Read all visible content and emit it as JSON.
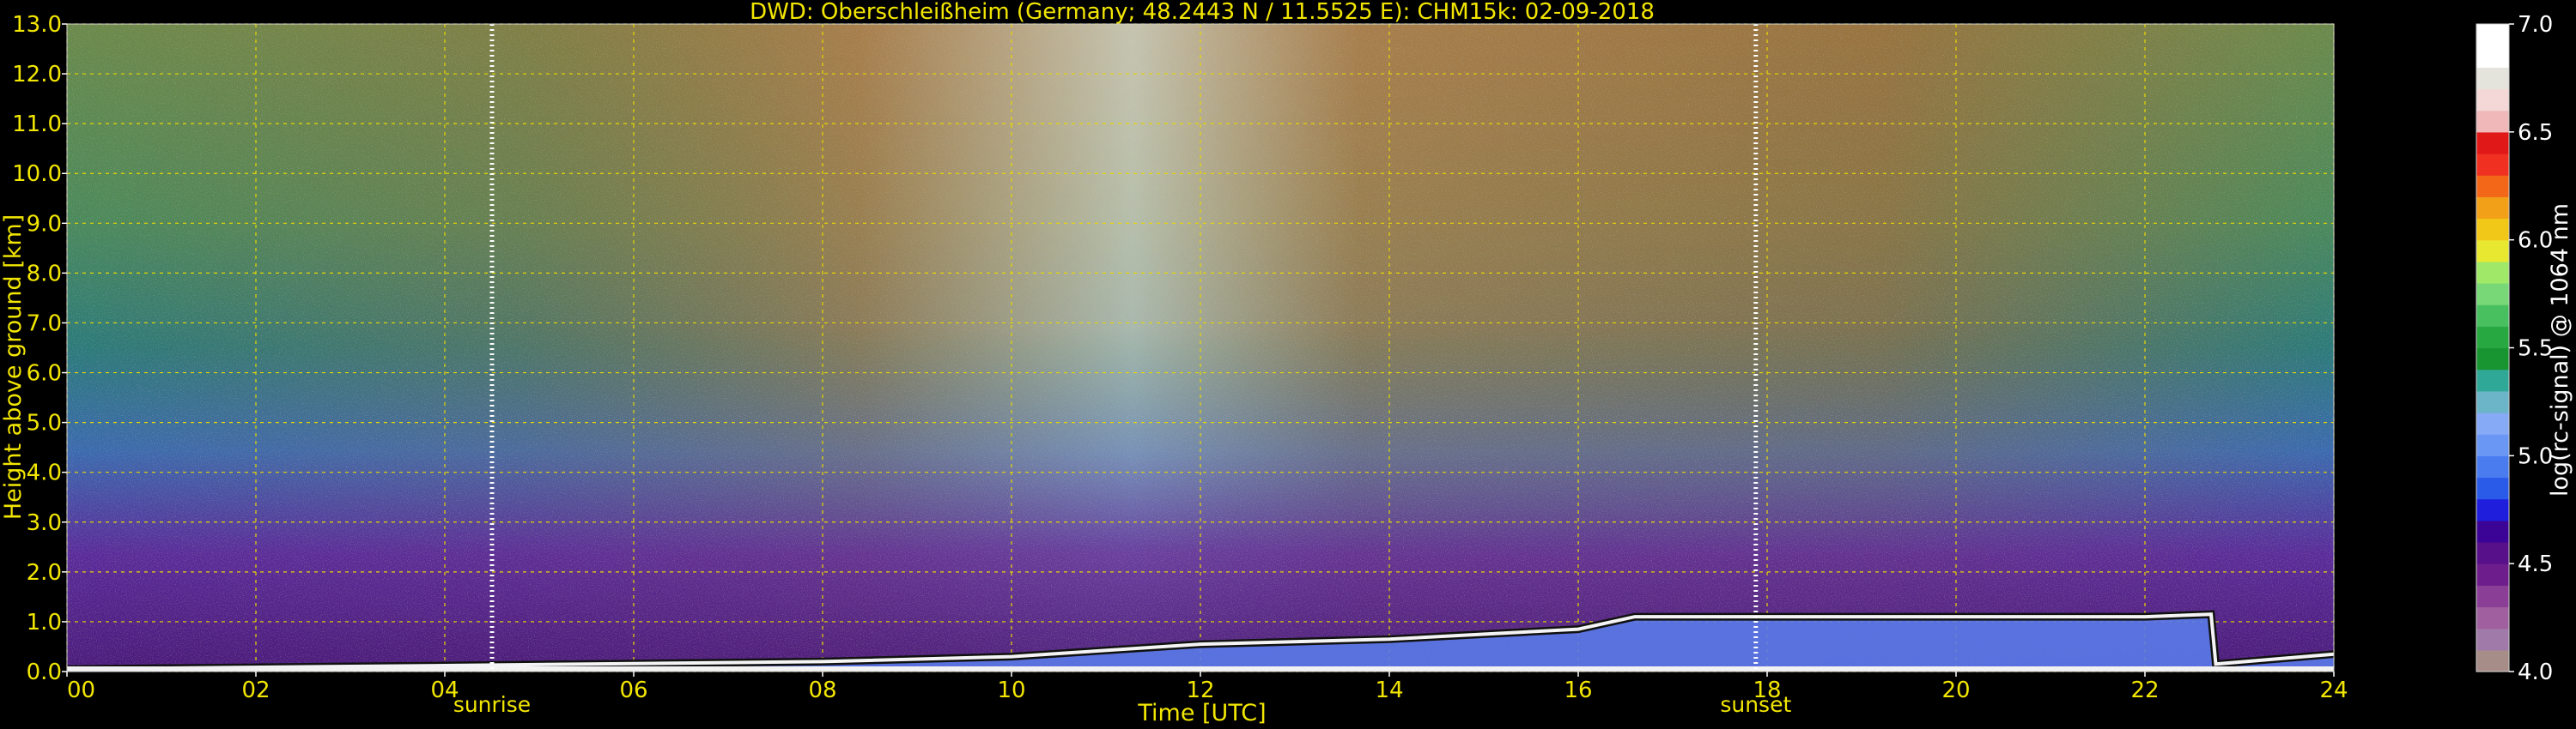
{
  "chart_data": {
    "type": "heatmap",
    "title": "DWD: Oberschleißheim (Germany; 48.2443 N / 11.5525 E):    CHM15k: 02-09-2018",
    "xlabel": "Time [UTC]",
    "ylabel": "Height above ground [km]",
    "xlim": [
      0,
      24
    ],
    "ylim": [
      0,
      13
    ],
    "x_ticks": [
      "00",
      "02",
      "04",
      "06",
      "08",
      "10",
      "12",
      "14",
      "16",
      "18",
      "20",
      "22",
      "24"
    ],
    "y_ticks": [
      "0.0",
      "1.0",
      "2.0",
      "3.0",
      "4.0",
      "5.0",
      "6.0",
      "7.0",
      "8.0",
      "9.0",
      "10.0",
      "11.0",
      "12.0",
      "13.0"
    ],
    "grid": true,
    "annotations": [
      {
        "label": "sunrise",
        "x": 4.5
      },
      {
        "label": "sunset",
        "x": 17.88
      }
    ],
    "colorbar": {
      "label": "log(rc-signal) @ 1064 nm",
      "range": [
        4.0,
        7.0
      ],
      "ticks": [
        "4.0",
        "4.5",
        "5.0",
        "5.5",
        "6.0",
        "6.5",
        "7.0"
      ],
      "colors": [
        "#a78d88",
        "#a07aa8",
        "#a060a0",
        "#8a3e96",
        "#6e1e8c",
        "#58108a",
        "#3c0496",
        "#1e1edc",
        "#2a5ae8",
        "#4a7cf0",
        "#6a96f4",
        "#86aaf6",
        "#6cb4c8",
        "#30a898",
        "#189430",
        "#28a840",
        "#48c060",
        "#78d878",
        "#a0e868",
        "#e8e830",
        "#f2c818",
        "#f2a018",
        "#f26818",
        "#f03020",
        "#e01818",
        "#f0b8b8",
        "#f4d8d8",
        "#e4e4dc",
        "#ffffff",
        "#ffffff"
      ]
    },
    "background_colors": {
      "low": "#5a2a9a",
      "mid": "#3a7ab8",
      "high": "#5a8a5a",
      "day": "#a86a3a",
      "noon": "#c8c0b4"
    },
    "cloud_top_km": [
      [
        0.0,
        0.05
      ],
      [
        4.0,
        0.12
      ],
      [
        8.0,
        0.2
      ],
      [
        10.0,
        0.3
      ],
      [
        12.0,
        0.55
      ],
      [
        14.0,
        0.65
      ],
      [
        16.0,
        0.85
      ],
      [
        16.6,
        1.1
      ],
      [
        20.0,
        1.1
      ],
      [
        22.0,
        1.1
      ],
      [
        22.7,
        1.15
      ],
      [
        22.75,
        0.15
      ],
      [
        24.0,
        0.35
      ]
    ]
  }
}
